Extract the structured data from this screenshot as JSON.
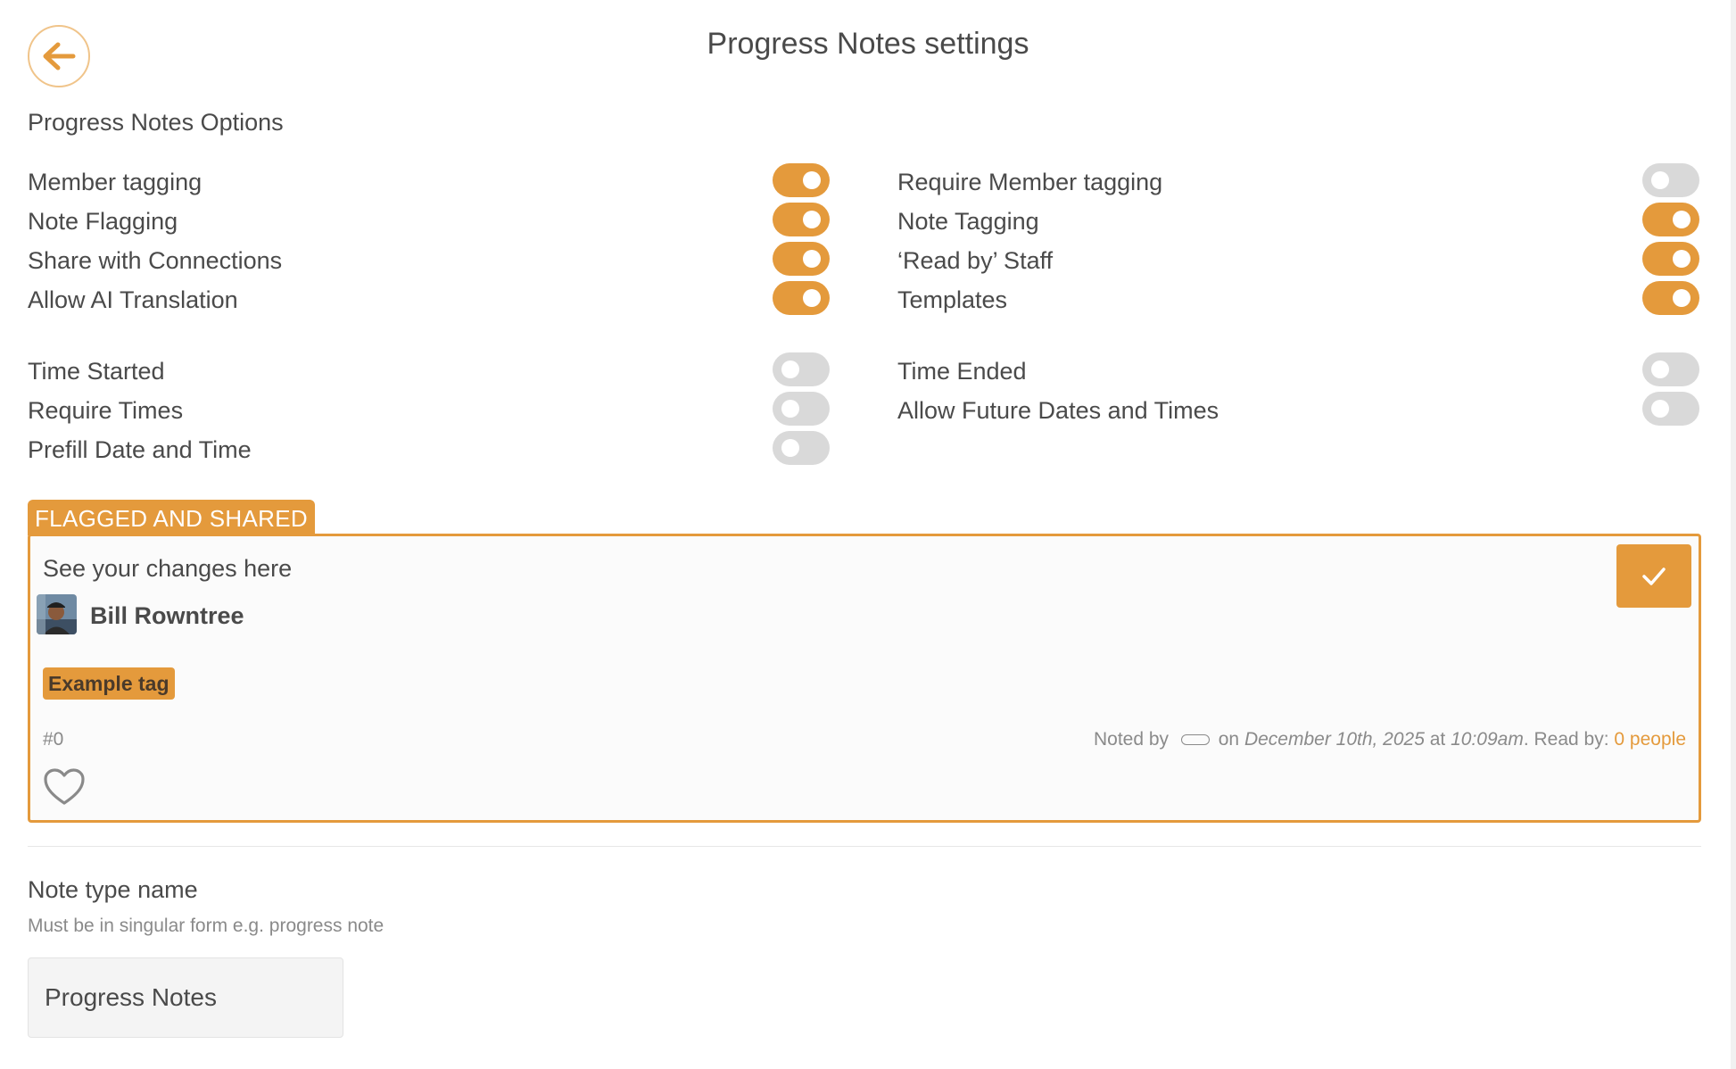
{
  "header": {
    "title": "Progress Notes settings",
    "back_icon": "arrow-left-icon"
  },
  "options": {
    "section_label": "Progress Notes Options",
    "left": [
      {
        "label": "Member tagging",
        "enabled": true
      },
      {
        "label": "Note Flagging",
        "enabled": true
      },
      {
        "label": "Share with Connections",
        "enabled": true
      },
      {
        "label": "Allow AI Translation",
        "enabled": true
      },
      {
        "label": "Time Started",
        "enabled": false
      },
      {
        "label": "Require Times",
        "enabled": false
      },
      {
        "label": "Prefill Date and Time",
        "enabled": false
      }
    ],
    "right": [
      {
        "label": "Require Member tagging",
        "enabled": false
      },
      {
        "label": "Note Tagging",
        "enabled": true
      },
      {
        "label": "‘Read by’ Staff",
        "enabled": true
      },
      {
        "label": "Templates",
        "enabled": true
      },
      {
        "label": "Time Ended",
        "enabled": false
      },
      {
        "label": "Allow Future Dates and Times",
        "enabled": false
      }
    ]
  },
  "preview": {
    "tab_label": "FLAGGED AND SHARED",
    "heading": "See your changes here",
    "author_name": "Bill Rowntree",
    "tag_label": "Example tag",
    "note_number": "#0",
    "noted_by_prefix": "Noted by",
    "on_word": "on",
    "date_text": "December 10th, 2025",
    "at_word": "at",
    "time_text": "10:09am",
    "read_by_prefix": ". Read by:",
    "read_by_count": "0 people",
    "like_icon": "heart-outline-icon",
    "confirm_icon": "checkmark-icon"
  },
  "note_type": {
    "label": "Note type name",
    "hint": "Must be in singular form e.g. progress note",
    "value": "Progress Notes"
  },
  "colors": {
    "accent": "#e49a3c",
    "toggle_off": "#d9d9d9",
    "text": "#4a4a4a"
  }
}
